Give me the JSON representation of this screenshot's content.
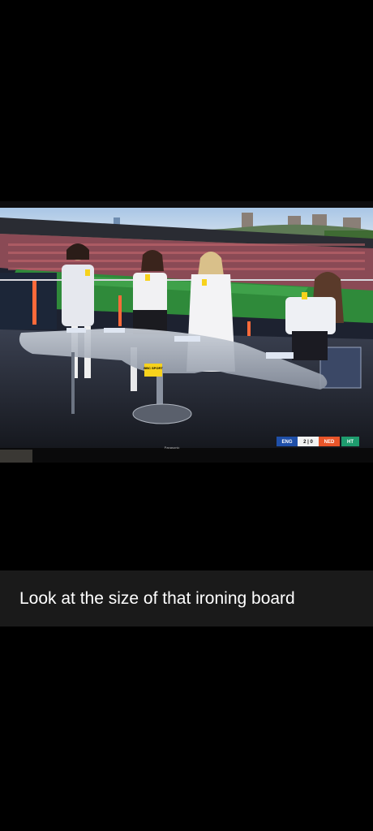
{
  "caption": {
    "text": "Look at the size of that ironing board"
  },
  "photo": {
    "tv_brand": "Panasonic",
    "desk_logo": "BBC SPORT",
    "score_bug": {
      "team_home": "ENG",
      "score": "2 | 0",
      "team_away": "NED",
      "period": "HT"
    }
  },
  "colors": {
    "caption_bar": "#1a1a1a",
    "caption_text": "#ffffff",
    "background": "#000000"
  }
}
